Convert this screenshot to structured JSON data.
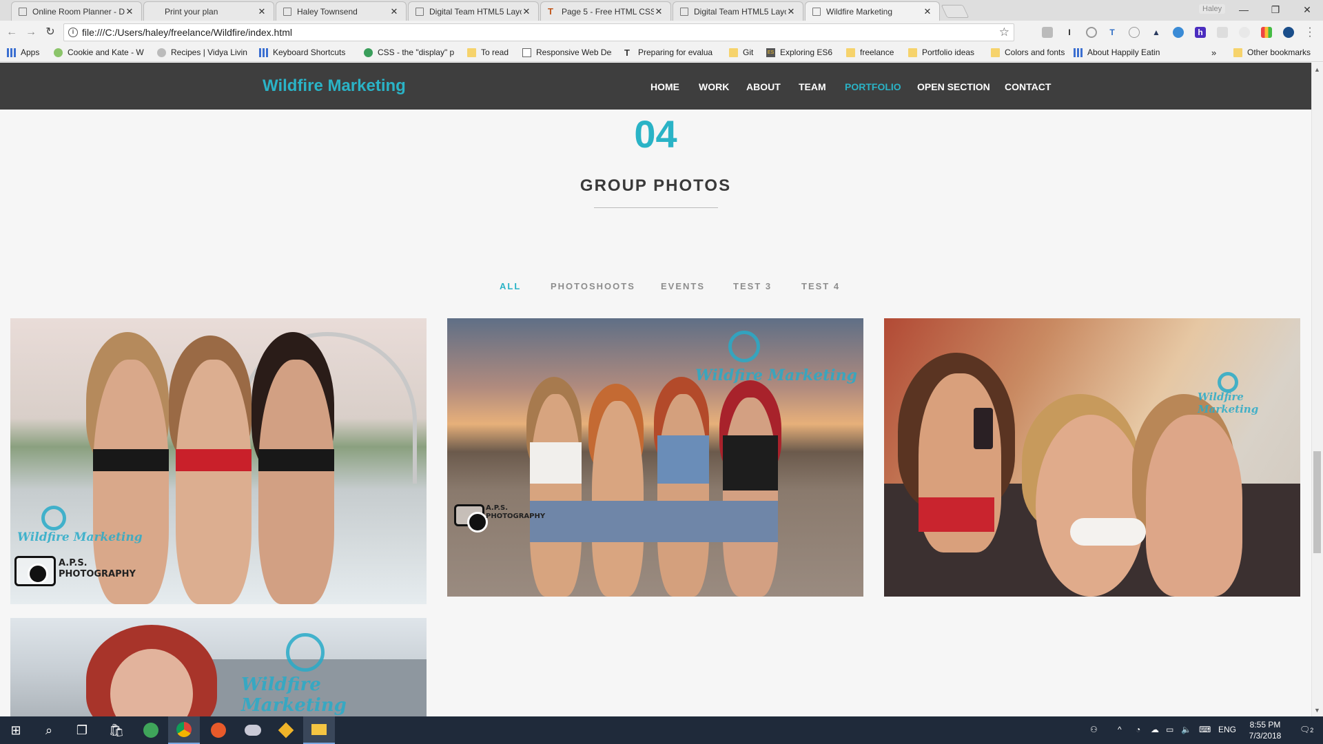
{
  "browser": {
    "tabs": [
      {
        "title": "Online Room Planner - D",
        "active": false
      },
      {
        "title": "Print your plan",
        "active": false
      },
      {
        "title": "Haley Townsend",
        "active": false
      },
      {
        "title": "Digital Team HTML5 Layo",
        "active": false
      },
      {
        "title": "Page 5 - Free HTML CSS",
        "active": false
      },
      {
        "title": "Digital Team HTML5 Layo",
        "active": false
      },
      {
        "title": "Wildfire Marketing",
        "active": true
      }
    ],
    "profile_name": "Haley",
    "url": "file:///C:/Users/haley/freelance/Wildfire/index.html",
    "bookmarks": [
      {
        "label": "Apps",
        "icon": "apps-grid-icon"
      },
      {
        "label": "Cookie and Kate - W",
        "icon": "leaf-icon"
      },
      {
        "label": "Recipes | Vidya Livin",
        "icon": "site-icon"
      },
      {
        "label": "Keyboard Shortcuts",
        "icon": "keyboard-icon"
      },
      {
        "label": "CSS - the \"display\" p",
        "icon": "globe-icon"
      },
      {
        "label": "To read",
        "icon": "folder-icon"
      },
      {
        "label": "Responsive Web Des",
        "icon": "page-icon"
      },
      {
        "label": "Preparing for evalua",
        "icon": "t-icon"
      },
      {
        "label": "Git",
        "icon": "folder-icon"
      },
      {
        "label": "Exploring ES6",
        "icon": "es6-icon"
      },
      {
        "label": "freelance",
        "icon": "folder-icon"
      },
      {
        "label": "Portfolio ideas",
        "icon": "folder-icon"
      },
      {
        "label": "Colors and fonts",
        "icon": "folder-icon"
      },
      {
        "label": "About Happily Eatin",
        "icon": "grid-icon"
      }
    ],
    "bookmarks_overflow": "»",
    "other_bookmarks": "Other bookmarks"
  },
  "site": {
    "brand": "Wildfire Marketing",
    "nav": [
      "HOME",
      "WORK",
      "ABOUT",
      "TEAM",
      "PORTFOLIO",
      "OPEN SECTION",
      "CONTACT"
    ],
    "nav_active": "PORTFOLIO",
    "section_number": "04",
    "section_title": "GROUP PHOTOS",
    "filters": [
      "ALL",
      "PHOTOSHOOTS",
      "EVENTS",
      "TEST 3",
      "TEST 4"
    ],
    "filter_active": "ALL",
    "watermark_text": "Wildfire Marketing",
    "photographer_text": "A.P.S. PHOTOGRAPHY"
  },
  "taskbar": {
    "language": "ENG",
    "time": "8:55 PM",
    "date": "7/3/2018",
    "notifications": "2"
  },
  "colors": {
    "accent": "#2ab3c6",
    "header_bg": "#3e3e3e",
    "page_bg": "#f6f6f6"
  }
}
